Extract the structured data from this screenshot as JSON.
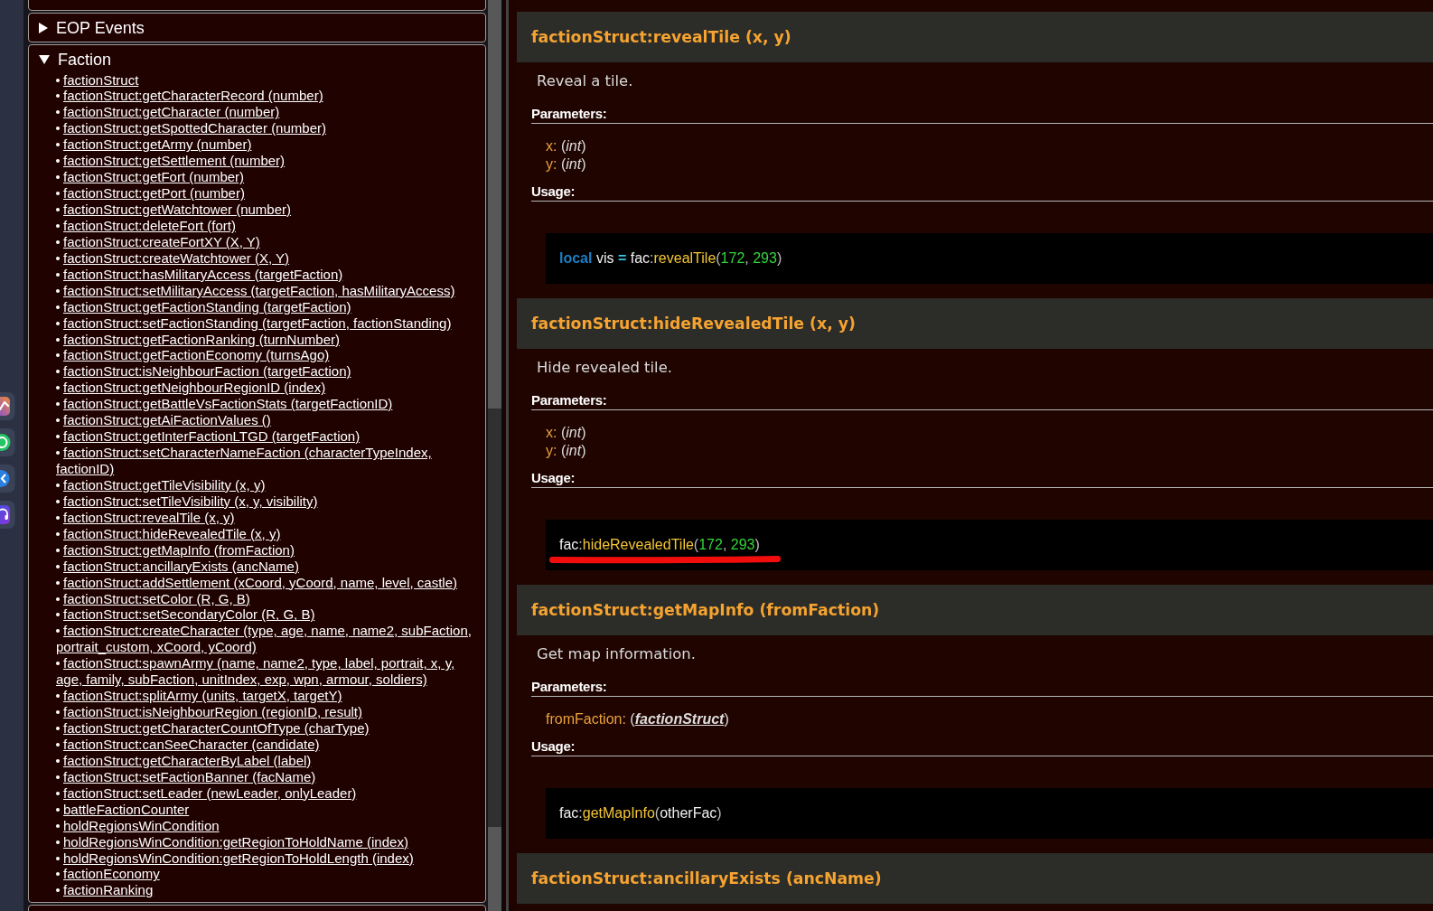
{
  "sidebar": {
    "sections": [
      {
        "title": "EOP Events",
        "expanded": false
      },
      {
        "title": "Faction",
        "expanded": true,
        "items": [
          "factionStruct",
          "factionStruct:getCharacterRecord (number)",
          "factionStruct:getCharacter (number)",
          "factionStruct:getSpottedCharacter (number)",
          "factionStruct:getArmy (number)",
          "factionStruct:getSettlement (number)",
          "factionStruct:getFort (number)",
          "factionStruct:getPort (number)",
          "factionStruct:getWatchtower (number)",
          "factionStruct:deleteFort (fort)",
          "factionStruct:createFortXY (X, Y)",
          "factionStruct:createWatchtower (X, Y)",
          "factionStruct:hasMilitaryAccess (targetFaction)",
          "factionStruct:setMilitaryAccess (targetFaction, hasMilitaryAccess)",
          "factionStruct:getFactionStanding (targetFaction)",
          "factionStruct:setFactionStanding (targetFaction, factionStanding)",
          "factionStruct:getFactionRanking (turnNumber)",
          "factionStruct:getFactionEconomy (turnsAgo)",
          "factionStruct:isNeighbourFaction (targetFaction)",
          "factionStruct:getNeighbourRegionID (index)",
          "factionStruct:getBattleVsFactionStats (targetFactionID)",
          "factionStruct:getAiFactionValues ()",
          "factionStruct:getInterFactionLTGD (targetFaction)",
          "factionStruct:setCharacterNameFaction (characterTypeIndex, factionID)",
          "factionStruct:getTileVisibility (x, y)",
          "factionStruct:setTileVisibility (x, y, visibility)",
          "factionStruct:revealTile (x, y)",
          "factionStruct:hideRevealedTile (x, y)",
          "factionStruct:getMapInfo (fromFaction)",
          "factionStruct:ancillaryExists (ancName)",
          "factionStruct:addSettlement (xCoord, yCoord, name, level, castle)",
          "factionStruct:setColor (R, G, B)",
          "factionStruct:setSecondaryColor (R, G, B)",
          "factionStruct:createCharacter (type, age, name, name2, subFaction, portrait_custom, xCoord, yCoord)",
          "factionStruct:spawnArmy (name, name2, type, label, portrait, x, y, age, family, subFaction, unitIndex, exp, wpn, armour, soldiers)",
          "factionStruct:splitArmy (units, targetX, targetY)",
          "factionStruct:isNeighbourRegion (regionID, result)",
          "factionStruct:getCharacterCountOfType (charType)",
          "factionStruct:canSeeCharacter (candidate)",
          "factionStruct:getCharacterByLabel (label)",
          "factionStruct:setFactionBanner (facName)",
          "factionStruct:setLeader (newLeader, onlyLeader)",
          "battleFactionCounter",
          "holdRegionsWinCondition",
          "holdRegionsWinCondition:getRegionToHoldName (index)",
          "holdRegionsWinCondition:getRegionToHoldLength (index)",
          "factionEconomy",
          "factionRanking"
        ]
      }
    ]
  },
  "content": {
    "sections": [
      {
        "title": "factionStruct:revealTile (x, y)",
        "description": "Reveal a tile.",
        "parameters_label": "Parameters:",
        "parameters": [
          {
            "name": "x:",
            "open": "(",
            "type": "int",
            "close": ")",
            "linked": false
          },
          {
            "name": "y:",
            "open": "(",
            "type": "int",
            "close": ")",
            "linked": false
          }
        ],
        "usage_label": "Usage:",
        "usage": [
          {
            "text": "local",
            "kind": "keyword"
          },
          {
            "text": " vis ",
            "kind": "plain"
          },
          {
            "text": "=",
            "kind": "operator"
          },
          {
            "text": " fac",
            "kind": "plain"
          },
          {
            "text": ":",
            "kind": "punct"
          },
          {
            "text": "revealTile",
            "kind": "method"
          },
          {
            "text": "(",
            "kind": "punct"
          },
          {
            "text": "172",
            "kind": "number"
          },
          {
            "text": ", ",
            "kind": "punct"
          },
          {
            "text": "293",
            "kind": "number"
          },
          {
            "text": ")",
            "kind": "punct"
          }
        ],
        "underlined": false
      },
      {
        "title": "factionStruct:hideRevealedTile (x, y)",
        "description": "Hide revealed tile.",
        "parameters_label": "Parameters:",
        "parameters": [
          {
            "name": "x:",
            "open": "(",
            "type": "int",
            "close": ")",
            "linked": false
          },
          {
            "name": "y:",
            "open": "(",
            "type": "int",
            "close": ")",
            "linked": false
          }
        ],
        "usage_label": "Usage:",
        "usage": [
          {
            "text": "fac",
            "kind": "plain"
          },
          {
            "text": ":",
            "kind": "punct"
          },
          {
            "text": "hideRevealedTile",
            "kind": "method"
          },
          {
            "text": "(",
            "kind": "punct"
          },
          {
            "text": "172",
            "kind": "number"
          },
          {
            "text": ", ",
            "kind": "punct"
          },
          {
            "text": "293",
            "kind": "number"
          },
          {
            "text": ")",
            "kind": "punct"
          }
        ],
        "underlined": true
      },
      {
        "title": "factionStruct:getMapInfo (fromFaction)",
        "description": "Get map information.",
        "parameters_label": "Parameters:",
        "parameters": [
          {
            "name": "fromFaction:",
            "open": "(",
            "type": "factionStruct",
            "close": ")",
            "linked": true
          }
        ],
        "usage_label": "Usage:",
        "usage": [
          {
            "text": "fac",
            "kind": "plain"
          },
          {
            "text": ":",
            "kind": "punct"
          },
          {
            "text": "getMapInfo",
            "kind": "method"
          },
          {
            "text": "(",
            "kind": "punct"
          },
          {
            "text": "otherFac",
            "kind": "plain"
          },
          {
            "text": ")",
            "kind": "punct"
          }
        ],
        "underlined": false
      },
      {
        "title": "factionStruct:ancillaryExists (ancName)"
      }
    ]
  }
}
